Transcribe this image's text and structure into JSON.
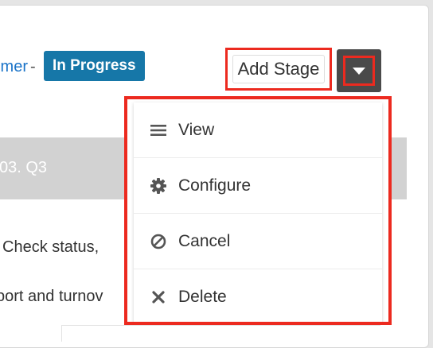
{
  "record": {
    "customer_link": "Customer",
    "separator": "-",
    "status": "In Progress"
  },
  "toolbar": {
    "add_stage_label": "Add Stage"
  },
  "stage": {
    "label": "03. Q3"
  },
  "task": {
    "text": "Check status,"
  },
  "description": {
    "text": "port and turnov"
  },
  "menu": {
    "items": [
      {
        "label": "View",
        "icon": "list-icon"
      },
      {
        "label": "Configure",
        "icon": "gear-icon"
      },
      {
        "label": "Cancel",
        "icon": "cancel-circle-icon"
      },
      {
        "label": "Delete",
        "icon": "x-icon"
      }
    ]
  },
  "colors": {
    "status_badge": "#1677a8",
    "highlight": "#ec2a1f",
    "link": "#1a73c8",
    "task_dot": "#8b5cf6"
  }
}
